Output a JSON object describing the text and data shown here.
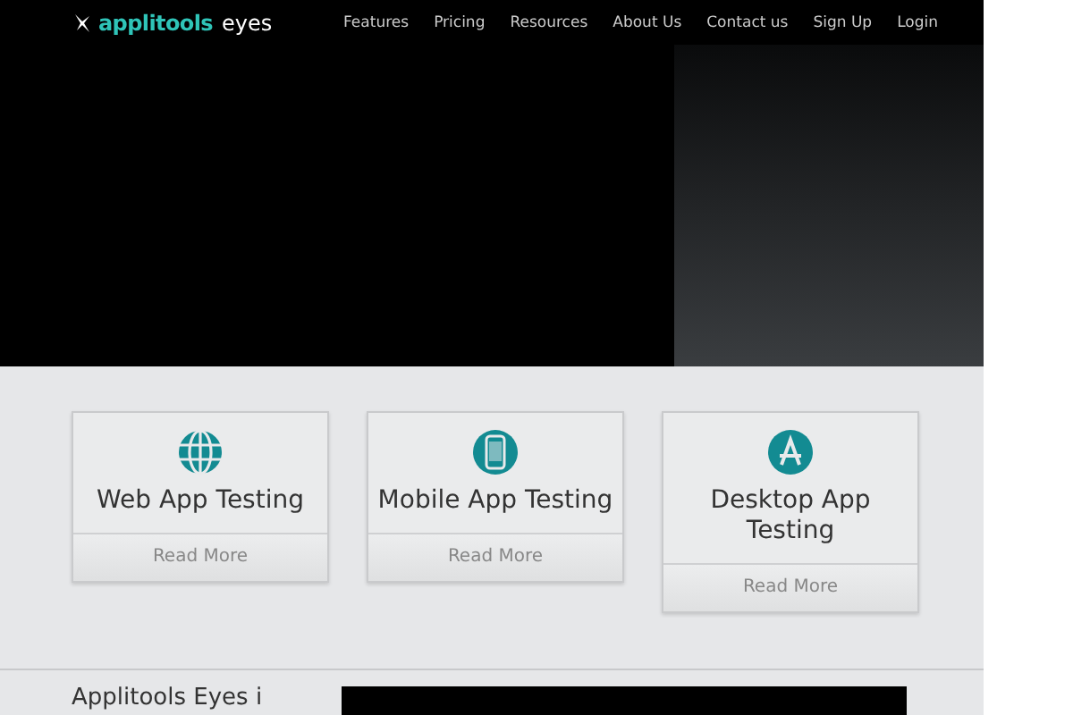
{
  "logo": {
    "brand": "applitools",
    "product": "eyes"
  },
  "nav": [
    "Features",
    "Pricing",
    "Resources",
    "About Us",
    "Contact us",
    "Sign Up",
    "Login"
  ],
  "cards": [
    {
      "kind": "globe",
      "title": "Web App Testing",
      "link": "Read More"
    },
    {
      "kind": "phone",
      "title": "Mobile App Testing",
      "link": "Read More"
    },
    {
      "kind": "appstore",
      "title": "Desktop App Testing",
      "link": "Read More"
    }
  ],
  "intro": {
    "heading": "Applitools Eyes i"
  }
}
